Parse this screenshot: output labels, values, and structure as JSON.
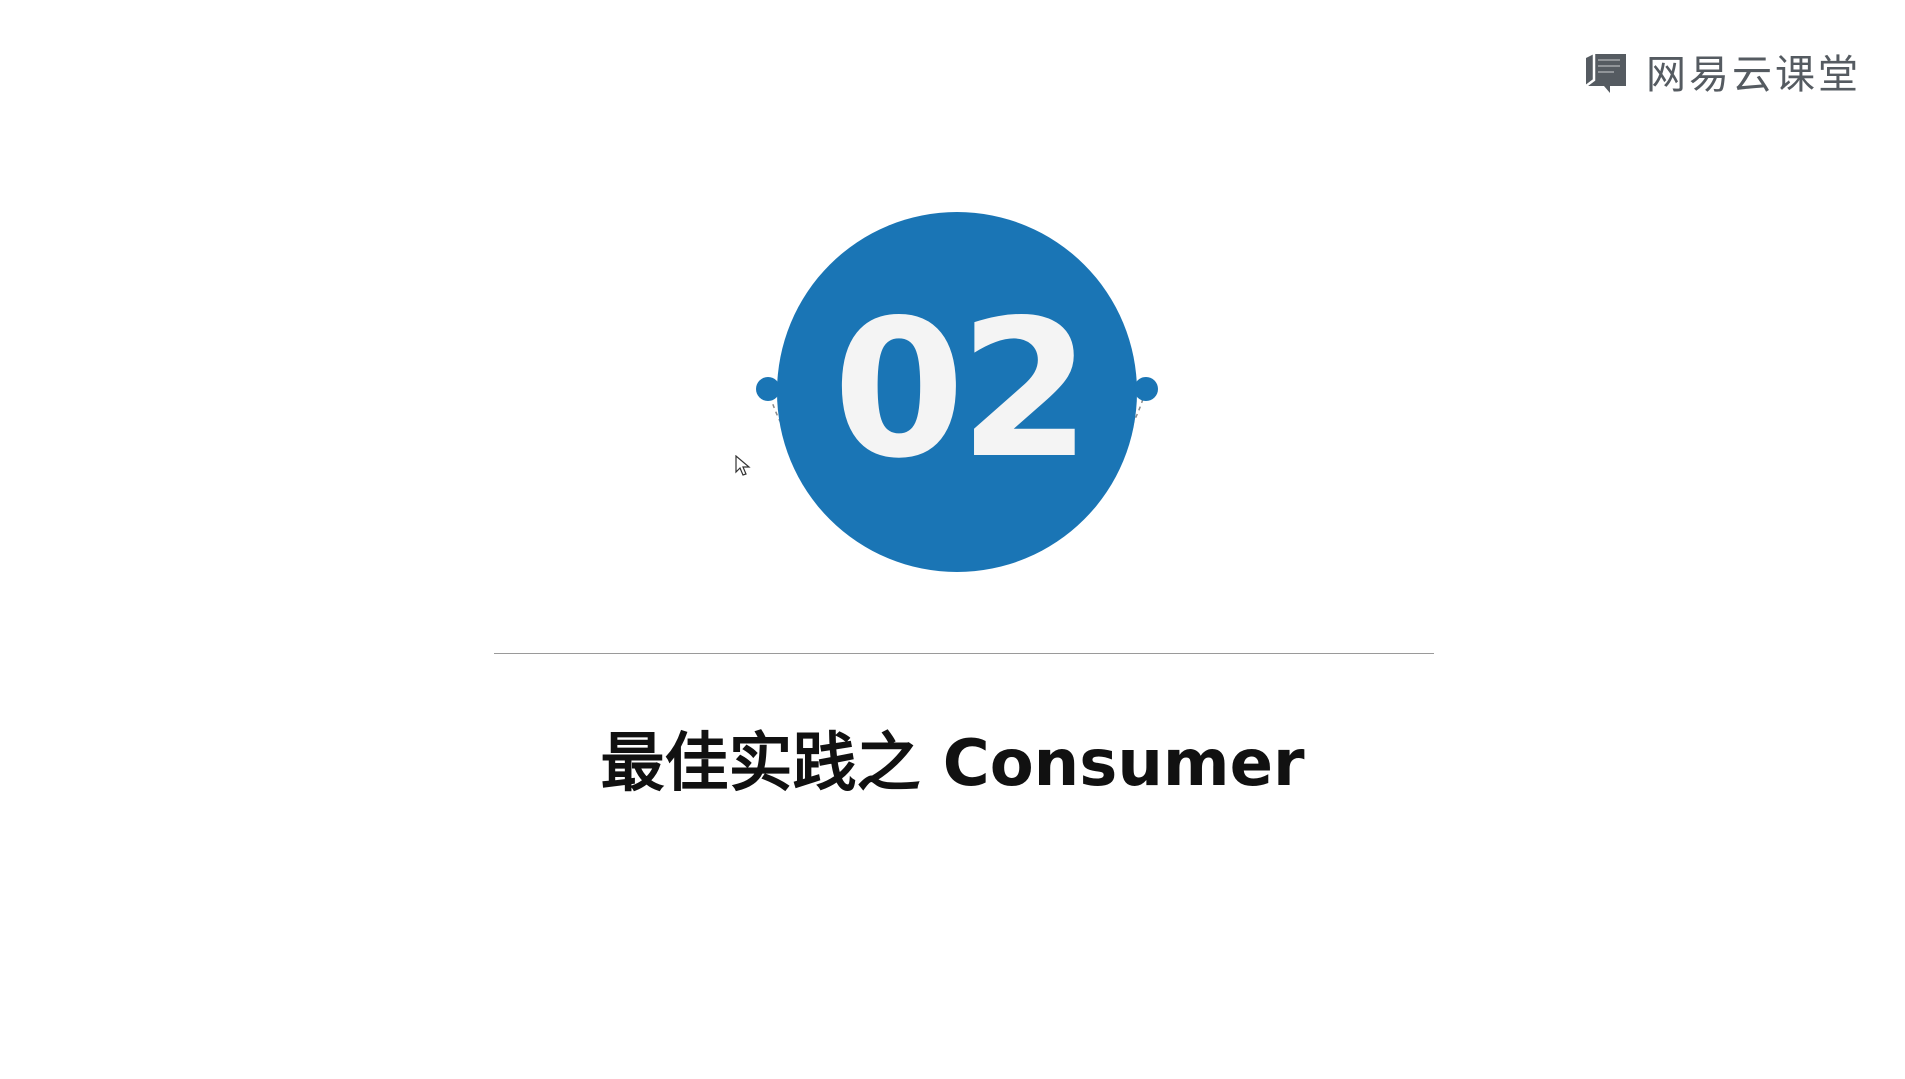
{
  "brand": {
    "name": "网易云课堂",
    "icon": "book-logo-icon",
    "color": "#555b61"
  },
  "badge": {
    "number": "02",
    "circle_color": "#1a75b5",
    "number_color": "#f4f4f4"
  },
  "title": "最佳实践之 Consumer",
  "cursor": {
    "icon": "mouse-pointer-icon"
  }
}
